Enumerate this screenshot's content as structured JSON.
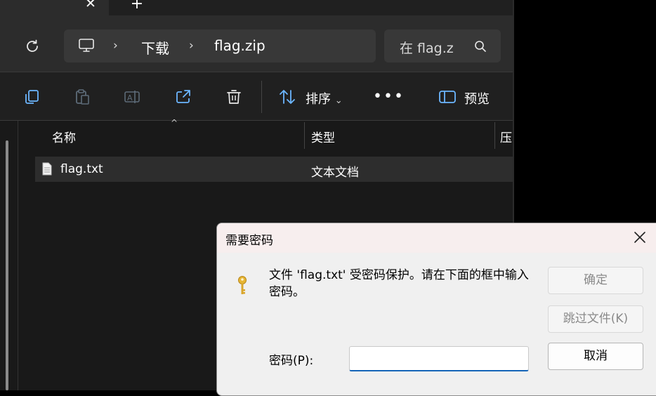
{
  "tabs": {
    "close_glyph": "✕",
    "new_tab_glyph": "+"
  },
  "address": {
    "crumbs": [
      "下载",
      "flag.zip"
    ],
    "chevron": "›"
  },
  "search": {
    "placeholder": "在 flag.z"
  },
  "toolbar": {
    "sort_label": "排序",
    "sort_caret": "⌄",
    "more_label": "•••",
    "preview_label": "预览"
  },
  "list": {
    "sort_caret": "^",
    "columns": {
      "name": "名称",
      "type": "类型",
      "compressed": "压"
    },
    "rows": [
      {
        "name": "flag.txt",
        "type": "文本文档"
      }
    ]
  },
  "dialog": {
    "title": "需要密码",
    "message": "文件 'flag.txt' 受密码保护。请在下面的框中输入密码。",
    "ok_label": "确定",
    "skip_label": "跳过文件(K)",
    "cancel_label": "取消",
    "password_label": "密码(P):",
    "password_value": ""
  },
  "colors": {
    "explorer_bg": "#191919",
    "toolbar_bg": "#202020",
    "accent": "#1464b8",
    "icon_blue": "#6cb6ff",
    "key_gold": "#e6b534"
  }
}
